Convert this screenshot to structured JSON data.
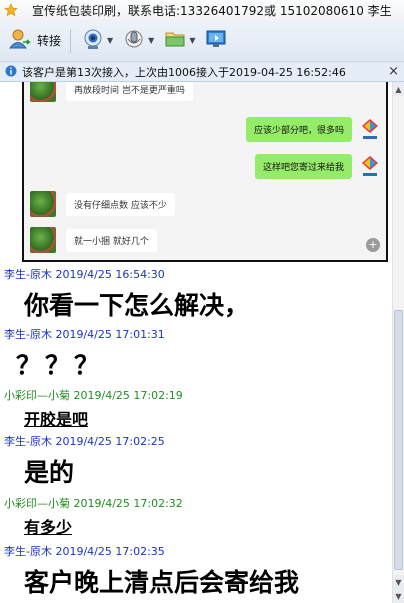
{
  "title": "宣传纸包装印刷，联系电话:13326401792或 15102080610 李生",
  "toolbar": {
    "transfer_label": "转接",
    "items": [
      "transfer",
      "camera",
      "audio",
      "folder",
      "screen"
    ]
  },
  "infobar": {
    "text": "该客户是第13次接入，上次由1006接入于2019-04-25 16:52:46",
    "close": "×"
  },
  "embed": {
    "messages": [
      {
        "side": "left",
        "text": "再放段时间 岂不是更严重吗"
      },
      {
        "side": "right",
        "text": "应该少部分吧，很多吗"
      },
      {
        "side": "right",
        "text": "这样吧您寄过来给我"
      },
      {
        "side": "left",
        "text": "没有仔细点数  应该不少"
      },
      {
        "side": "left",
        "text": "就一小捆 就好几个"
      }
    ],
    "zoom_icon": "+"
  },
  "messages": [
    {
      "sender": "李生-原木",
      "time": "2019/4/25 16:54:30",
      "color": "#1a34c8",
      "text": "你看一下怎么解决，"
    },
    {
      "sender": "李生-原木",
      "time": "2019/4/25 17:01:31",
      "color": "#1a34c8",
      "text": "？？？"
    },
    {
      "sender": "小彩印—小菊",
      "time": "2019/4/25 17:02:19",
      "color": "#1f8f1f",
      "text": "开胶是吧"
    },
    {
      "sender": "李生-原木",
      "time": "2019/4/25 17:02:25",
      "color": "#1a34c8",
      "text": "是的"
    },
    {
      "sender": "小彩印—小菊",
      "time": "2019/4/25 17:02:32",
      "color": "#1f8f1f",
      "text": "有多少"
    },
    {
      "sender": "李生-原木",
      "time": "2019/4/25 17:02:35",
      "color": "#1a34c8",
      "text": "客户晚上清点后会寄给我"
    }
  ]
}
